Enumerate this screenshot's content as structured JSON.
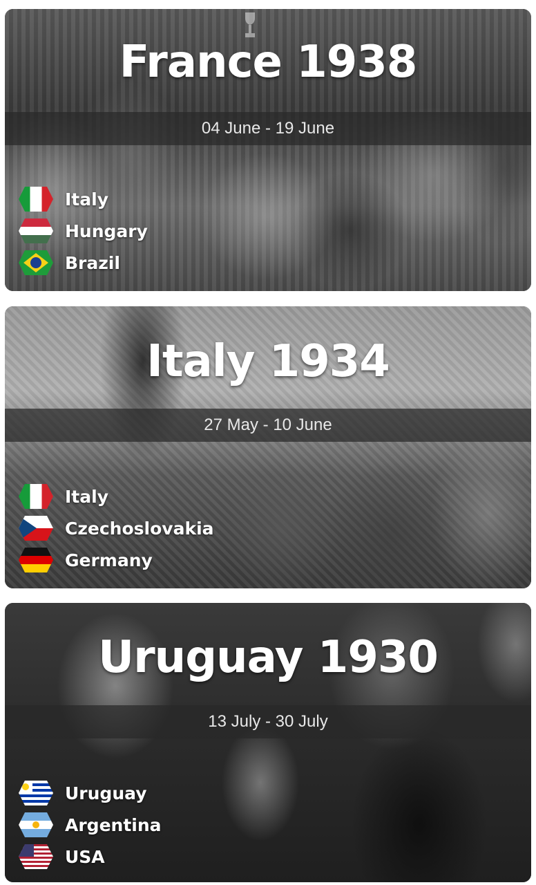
{
  "cups": [
    {
      "title": "France 1938",
      "dates": "04 June - 19 June",
      "teams": [
        {
          "name": "Italy",
          "flag": "italy-flag-icon"
        },
        {
          "name": "Hungary",
          "flag": "hungary-flag-icon"
        },
        {
          "name": "Brazil",
          "flag": "brazil-flag-icon"
        }
      ]
    },
    {
      "title": "Italy 1934",
      "dates": "27 May - 10 June",
      "teams": [
        {
          "name": "Italy",
          "flag": "italy-flag-icon"
        },
        {
          "name": "Czechoslovakia",
          "flag": "czechoslovakia-flag-icon"
        },
        {
          "name": "Germany",
          "flag": "germany-flag-icon"
        }
      ]
    },
    {
      "title": "Uruguay 1930",
      "dates": "13 July - 30 July",
      "teams": [
        {
          "name": "Uruguay",
          "flag": "uruguay-flag-icon"
        },
        {
          "name": "Argentina",
          "flag": "argentina-flag-icon"
        },
        {
          "name": "USA",
          "flag": "usa-flag-icon"
        }
      ]
    }
  ],
  "colors": {
    "title_text": "#ffffff",
    "date_band": "#282828",
    "date_text": "#e8e8e8"
  }
}
